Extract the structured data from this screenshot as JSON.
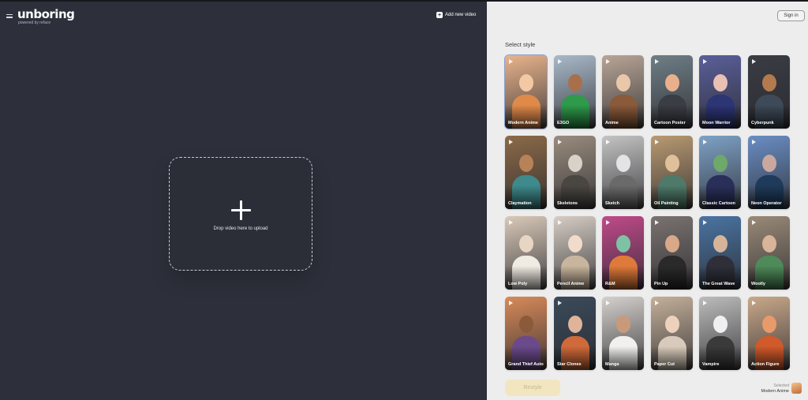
{
  "app": {
    "logo_text": "unboring",
    "logo_sub": "powered by reface",
    "add_video_label": "Add new video"
  },
  "upload": {
    "drop_text": "Drop video here to upload"
  },
  "panel": {
    "signin_label": "Sign in",
    "select_style_label": "Select style",
    "restyle_label": "Restyle",
    "selected_caption": "Selected",
    "selected_style": "Modern Anime"
  },
  "styles": [
    {
      "label": "Modern Anime",
      "bg": "#e9b48c",
      "skin": "#f3c9a4",
      "cloth": "#e08a4a",
      "selected": true
    },
    {
      "label": "E3GO",
      "bg": "#a9b9c9",
      "skin": "#a8704a",
      "cloth": "#2e9a4a"
    },
    {
      "label": "Anime",
      "bg": "#b8a596",
      "skin": "#e9c7a9",
      "cloth": "#8a5a3a"
    },
    {
      "label": "Cartoon Poster",
      "bg": "#6f7e86",
      "skin": "#e8b08c",
      "cloth": "#3a3d44"
    },
    {
      "label": "Moon Warrior",
      "bg": "#5a5f9a",
      "skin": "#e8c0b4",
      "cloth": "#2d3575"
    },
    {
      "label": "Cyberpunk",
      "bg": "#3a3c44",
      "skin": "#b37a4e",
      "cloth": "#3e4a58"
    },
    {
      "label": "Claymation",
      "bg": "#8c6a48",
      "skin": "#b88258",
      "cloth": "#3f8a8c"
    },
    {
      "label": "Skeletons",
      "bg": "#9a8c7e",
      "skin": "#d8d2c8",
      "cloth": "#4a4642"
    },
    {
      "label": "Sketch",
      "bg": "#c4c4c4",
      "skin": "#e4e4e4",
      "cloth": "#6a6a6a"
    },
    {
      "label": "Oil Painting",
      "bg": "#b99a72",
      "skin": "#e0c09a",
      "cloth": "#4f7a6a"
    },
    {
      "label": "Classic Cartoon",
      "bg": "#7ea2c6",
      "skin": "#6ea86a",
      "cloth": "#2a2f5a"
    },
    {
      "label": "Neon Operator",
      "bg": "#6a8ec4",
      "skin": "#c9a8a0",
      "cloth": "#1f3a5a"
    },
    {
      "label": "Low Poly",
      "bg": "#d9c9b9",
      "skin": "#e8d6c4",
      "cloth": "#f0ece4"
    },
    {
      "label": "Pencil Anime",
      "bg": "#d6cdc4",
      "skin": "#f1dccb",
      "cloth": "#c9b59e"
    },
    {
      "label": "R&M",
      "bg": "#c04a8a",
      "skin": "#7ec2a4",
      "cloth": "#e07a3a"
    },
    {
      "label": "Pin Up",
      "bg": "#7a7270",
      "skin": "#d8a888",
      "cloth": "#2a2a2a"
    },
    {
      "label": "The Great Wave",
      "bg": "#4a74a2",
      "skin": "#d6b49a",
      "cloth": "#2f2f3a"
    },
    {
      "label": "Woolly",
      "bg": "#9a8a78",
      "skin": "#d8b49a",
      "cloth": "#4f8a5a"
    },
    {
      "label": "Grand Thief Auto",
      "bg": "#d88a5a",
      "skin": "#8a5a3a",
      "cloth": "#6a4a8a"
    },
    {
      "label": "Star Clones",
      "bg": "#3a4a5a",
      "skin": "#e0b49a",
      "cloth": "#d06a3a"
    },
    {
      "label": "Manga",
      "bg": "#d4d0cc",
      "skin": "#c99a7a",
      "cloth": "#f2f0ee"
    },
    {
      "label": "Paper Cut",
      "bg": "#c4b09a",
      "skin": "#ecd2bc",
      "cloth": "#d8cbbb"
    },
    {
      "label": "Vampire",
      "bg": "#bcbcbc",
      "skin": "#f0f0f0",
      "cloth": "#3a3a3a"
    },
    {
      "label": "Action Figure",
      "bg": "#c9a88a",
      "skin": "#e89a6a",
      "cloth": "#d05a2a"
    }
  ]
}
